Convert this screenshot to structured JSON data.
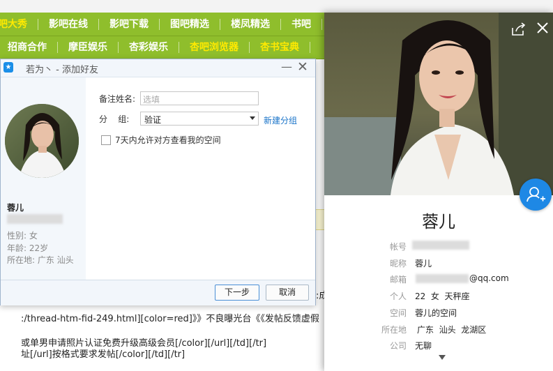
{
  "nav_row1": [
    "吧大秀",
    "影吧在线",
    "影吧下载",
    "图吧精选",
    "楼凤精选",
    "书吧"
  ],
  "nav_row2": [
    "招商合作",
    "摩臣娱乐",
    "杏彩娱乐",
    "杏吧浏览器",
    "杏书宝典"
  ],
  "nav_highlight": "#ffea00",
  "bg_text": {
    "line1": ":/thread-htm-fid-249.html][color=red]》》不良曝光台《《发帖反馈虚假",
    "line2": "或单男申请照片认证免费升级高级会员[/color][/url][/td][/tr]",
    "line3": "址[/url]按格式要求发帖[/color][/td][/tr]",
    "side": ":成"
  },
  "dialog": {
    "title": "若为丶 - 添加好友",
    "icons": {
      "app": "qq-icon",
      "minimize": "minimize-icon",
      "close": "close-icon"
    },
    "profile": {
      "nickname": "蓉儿",
      "gender": "性别: 女",
      "age": "年龄: 22岁",
      "location": "所在地: 广东  汕头"
    },
    "form": {
      "remark_label": "备注姓名:",
      "remark_placeholder": "选填",
      "group_label": "分    组:",
      "group_value": "验证",
      "new_group_link": "新建分组",
      "space_checkbox_label": "7天内允许对方查看我的空间",
      "space_checked": false
    },
    "buttons": {
      "next": "下一步",
      "cancel": "取消"
    }
  },
  "card": {
    "name": "蓉儿",
    "icons": {
      "share": "share-icon",
      "close": "close-icon",
      "add_friend": "add-friend-icon",
      "more": "chevron-down-icon"
    },
    "rows": [
      {
        "label": "帐号",
        "value": ""
      },
      {
        "label": "昵称",
        "value": "蓉儿"
      },
      {
        "label": "邮箱",
        "value": "@qq.com"
      },
      {
        "label": "个人",
        "value": "22  女  天秤座"
      },
      {
        "label": "空间",
        "value": "蓉儿的空间"
      },
      {
        "label": "所在地",
        "value": "广东  汕头  龙湖区"
      },
      {
        "label": "公司",
        "value": "无聊"
      }
    ]
  },
  "colors": {
    "nav_green": "#8fbe2c",
    "accent_blue": "#1e88e5",
    "link_blue": "#1a74c9"
  }
}
